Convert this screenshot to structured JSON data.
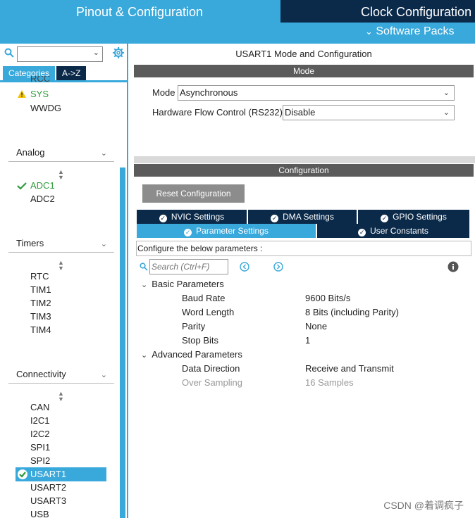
{
  "top": {
    "pinout_tab": "Pinout & Configuration",
    "clock_tab": "Clock Configuration",
    "software_packs": "Software Packs"
  },
  "left": {
    "search_value": "",
    "tabs": [
      "Categories",
      "A->Z"
    ],
    "system_items": [
      "RCC",
      "SYS",
      "WWDG"
    ],
    "groups": {
      "analog": {
        "title": "Analog",
        "items": [
          "ADC1",
          "ADC2"
        ]
      },
      "timers": {
        "title": "Timers",
        "items": [
          "RTC",
          "TIM1",
          "TIM2",
          "TIM3",
          "TIM4"
        ]
      },
      "connectivity": {
        "title": "Connectivity",
        "items": [
          "CAN",
          "I2C1",
          "I2C2",
          "SPI1",
          "SPI2",
          "USART1",
          "USART2",
          "USART3",
          "USB"
        ]
      }
    }
  },
  "right": {
    "title": "USART1 Mode and Configuration",
    "mode_header": "Mode",
    "mode_label": "Mode",
    "mode_value": "Asynchronous",
    "flow_label": "Hardware Flow Control (RS232)",
    "flow_value": "Disable",
    "config_header": "Configuration",
    "reset_button": "Reset Configuration",
    "tabs_row1": [
      "NVIC Settings",
      "DMA Settings",
      "GPIO Settings"
    ],
    "tabs_row2": [
      "Parameter Settings",
      "User Constants"
    ],
    "configure_text": "Configure the below parameters :",
    "search_placeholder": "Search (Ctrl+F)",
    "basic": {
      "title": "Basic Parameters",
      "rows": [
        {
          "name": "Baud Rate",
          "value": "9600 Bits/s"
        },
        {
          "name": "Word Length",
          "value": "8 Bits (including Parity)"
        },
        {
          "name": "Parity",
          "value": "None"
        },
        {
          "name": "Stop Bits",
          "value": "1"
        }
      ]
    },
    "advanced": {
      "title": "Advanced Parameters",
      "rows": [
        {
          "name": "Data Direction",
          "value": "Receive and Transmit"
        },
        {
          "name": "Over Sampling",
          "value": "16 Samples"
        }
      ]
    }
  },
  "watermark": "CSDN @着调疯子",
  "colors": {
    "accent": "#39a8db",
    "dark": "#0b2a4a",
    "ok": "#2e9b3a"
  }
}
